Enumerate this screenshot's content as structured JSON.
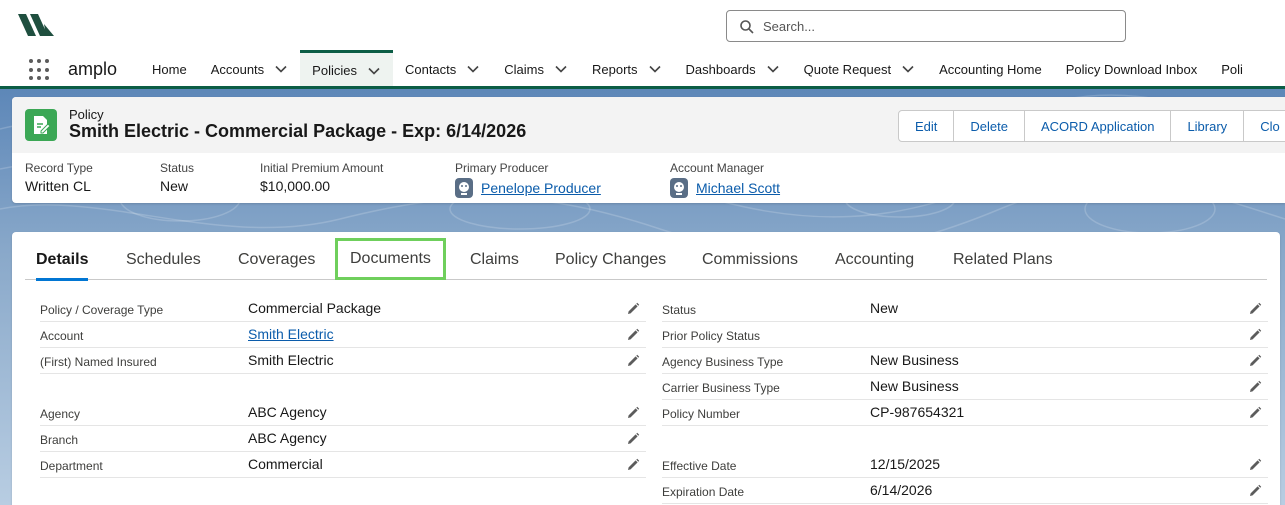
{
  "header": {
    "search_placeholder": "Search...",
    "app_name": "amplo"
  },
  "nav": {
    "items": [
      {
        "label": "Home",
        "dropdown": false
      },
      {
        "label": "Accounts",
        "dropdown": true
      },
      {
        "label": "Policies",
        "dropdown": true,
        "active": true
      },
      {
        "label": "Contacts",
        "dropdown": true
      },
      {
        "label": "Claims",
        "dropdown": true
      },
      {
        "label": "Reports",
        "dropdown": true
      },
      {
        "label": "Dashboards",
        "dropdown": true
      },
      {
        "label": "Quote Request",
        "dropdown": true
      },
      {
        "label": "Accounting Home",
        "dropdown": false
      },
      {
        "label": "Policy Download Inbox",
        "dropdown": false
      },
      {
        "label": "Poli",
        "dropdown": false
      }
    ]
  },
  "record": {
    "object_label": "Policy",
    "title": "Smith Electric - Commercial Package - Exp: 6/14/2026",
    "actions": [
      "Edit",
      "Delete",
      "ACORD Application",
      "Library",
      "Clo"
    ],
    "highlights": [
      {
        "label": "Record Type",
        "value": "Written CL",
        "link": false
      },
      {
        "label": "Status",
        "value": "New",
        "link": false
      },
      {
        "label": "Initial Premium Amount",
        "value": "$10,000.00",
        "link": false
      },
      {
        "label": "Primary Producer",
        "value": "Penelope Producer",
        "link": true
      },
      {
        "label": "Account Manager",
        "value": "Michael Scott",
        "link": true
      }
    ]
  },
  "tabs": [
    "Details",
    "Schedules",
    "Coverages",
    "Documents",
    "Claims",
    "Policy Changes",
    "Commissions",
    "Accounting",
    "Related Plans"
  ],
  "details": {
    "left": [
      {
        "label": "Policy / Coverage Type",
        "value": "Commercial Package",
        "link": false
      },
      {
        "label": "Account",
        "value": "Smith Electric",
        "link": true
      },
      {
        "label": "(First) Named Insured",
        "value": "Smith Electric",
        "link": false
      },
      {
        "label": "Agency",
        "value": "ABC Agency",
        "link": false
      },
      {
        "label": "Branch",
        "value": "ABC Agency",
        "link": false
      },
      {
        "label": "Department",
        "value": "Commercial",
        "link": false
      }
    ],
    "right": [
      {
        "label": "Status",
        "value": "New",
        "link": false
      },
      {
        "label": "Prior Policy Status",
        "value": "",
        "link": false
      },
      {
        "label": "Agency Business Type",
        "value": "New Business",
        "link": false
      },
      {
        "label": "Carrier Business Type",
        "value": "New Business",
        "link": false
      },
      {
        "label": "Policy Number",
        "value": "CP-987654321",
        "link": false
      },
      {
        "label": "Effective Date",
        "value": "12/15/2025",
        "link": false
      },
      {
        "label": "Expiration Date",
        "value": "6/14/2026",
        "link": false
      }
    ]
  },
  "colors": {
    "brand": "#0b5d45",
    "link": "#0b5cab",
    "record_icon": "#3ba755",
    "tab_highlight": "#6fcf5c",
    "active_tab_underline": "#0176d3"
  }
}
